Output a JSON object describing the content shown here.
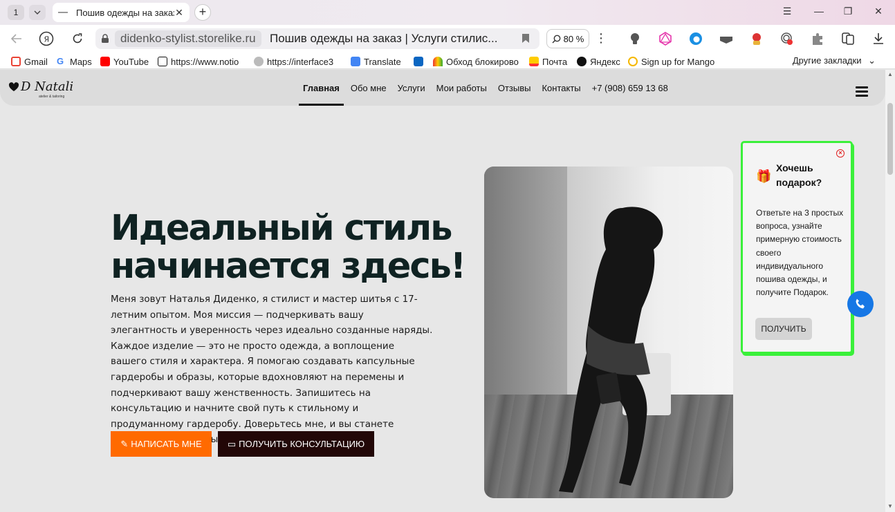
{
  "browser": {
    "tab_count": "1",
    "tab_title": "Пошив одежды на заказ",
    "domain": "didenko-stylist.storelike.ru",
    "page_title": "Пошив одежды на заказ | Услуги стилис...",
    "zoom": "80 %",
    "bookmarks": [
      {
        "label": "Gmail"
      },
      {
        "label": "Maps"
      },
      {
        "label": "YouTube"
      },
      {
        "label": "https://www.notio"
      },
      {
        "label": "https://interface3"
      },
      {
        "label": "Translate"
      },
      {
        "label": "Обход блокирово"
      },
      {
        "label": "Почта"
      },
      {
        "label": "Яндекс"
      },
      {
        "label": "Sign up for Mango"
      }
    ],
    "other_bookmarks": "Другие закладки"
  },
  "site": {
    "logo_text": "D Natali",
    "logo_subtitle": "atelier & tailoring",
    "menu": [
      {
        "label": "Главная"
      },
      {
        "label": "Обо мне"
      },
      {
        "label": "Услуги"
      },
      {
        "label": "Мои работы"
      },
      {
        "label": "Отзывы"
      },
      {
        "label": "Контакты"
      },
      {
        "label": "+7 (908) 659 13 68"
      }
    ]
  },
  "hero": {
    "title": "Идеальный стиль начинается здесь!",
    "text": "Меня зовут Наталья Диденко, я стилист и мастер шитья с 17-летним опытом. Моя миссия — подчеркивать вашу элегантность и уверенность через идеально созданные наряды. Каждое изделие — это не просто одежда, а воплощение вашего стиля и характера. Я помогаю создавать капсульные гардеробы и образы, которые вдохновляют на перемены и подчеркивают вашу женственность. Запишитесь на консультацию и начните свой путь к стильному и продуманному гардеробу. Доверьтесь мне, и вы станете центром восхищенных взглядов!",
    "btn_write": "НАПИСАТЬ МНЕ",
    "btn_consult": "ПОЛУЧИТЬ КОНСУЛЬТАЦИЮ"
  },
  "popup": {
    "title": "Хочешь подарок?",
    "text": "Ответьте на 3 простых вопроса, узнайте примерную стоимость своего индивидуального пошива одежды, и получите Подарок.",
    "button": "ПОЛУЧИТЬ"
  },
  "colors": {
    "accent_orange": "#ff6a00",
    "dark_button": "#220707",
    "popup_border": "#3af03a",
    "phone_button": "#1677e5"
  }
}
